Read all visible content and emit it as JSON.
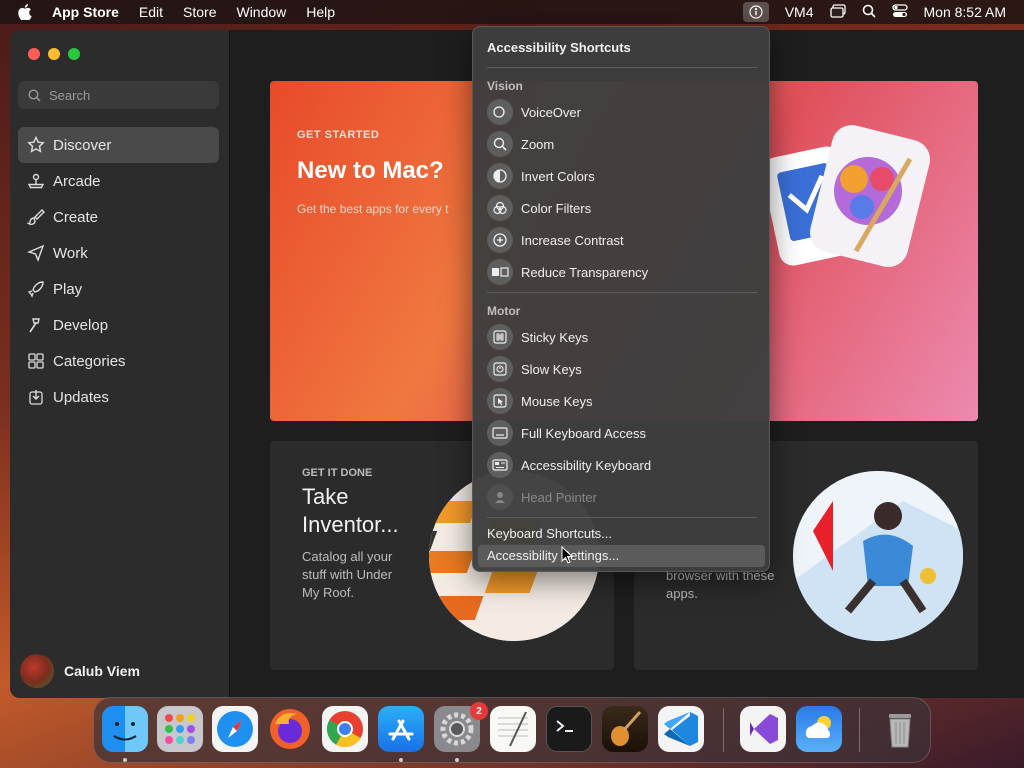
{
  "menubar": {
    "app_name": "App Store",
    "items": [
      "Edit",
      "Store",
      "Window",
      "Help"
    ],
    "status_user": "VM4",
    "clock": "Mon 8:52 AM"
  },
  "sidebar": {
    "search_placeholder": "Search",
    "items": [
      {
        "label": "Discover",
        "icon": "star-icon",
        "active": true
      },
      {
        "label": "Arcade",
        "icon": "joystick-icon"
      },
      {
        "label": "Create",
        "icon": "brush-icon"
      },
      {
        "label": "Work",
        "icon": "paper-plane-icon"
      },
      {
        "label": "Play",
        "icon": "rocket-icon"
      },
      {
        "label": "Develop",
        "icon": "hammer-icon"
      },
      {
        "label": "Categories",
        "icon": "grid-icon"
      },
      {
        "label": "Updates",
        "icon": "download-icon"
      }
    ],
    "user_name": "Calub Viem"
  },
  "hero": {
    "eyebrow": "GET STARTED",
    "title": "New to Mac?",
    "subtitle": "Get the best apps for every t"
  },
  "cards": [
    {
      "eyebrow": "GET IT DONE",
      "title": "Take Inventor...",
      "desc": "Catalog all your stuff with Under My Roof."
    },
    {
      "desc": "browser with these apps."
    }
  ],
  "accessibility_menu": {
    "title": "Accessibility Shortcuts",
    "vision_label": "Vision",
    "vision_items": [
      "VoiceOver",
      "Zoom",
      "Invert Colors",
      "Color Filters",
      "Increase Contrast",
      "Reduce Transparency"
    ],
    "motor_label": "Motor",
    "motor_items": [
      "Sticky Keys",
      "Slow Keys",
      "Mouse Keys",
      "Full Keyboard Access",
      "Accessibility Keyboard",
      "Head Pointer"
    ],
    "keyboard_shortcuts": "Keyboard Shortcuts...",
    "accessibility_settings": "Accessibility Settings..."
  },
  "dock": {
    "settings_badge": "2"
  },
  "colors": {
    "traffic_red": "#ff5f57",
    "traffic_yellow": "#febc2e",
    "traffic_green": "#28c840"
  }
}
